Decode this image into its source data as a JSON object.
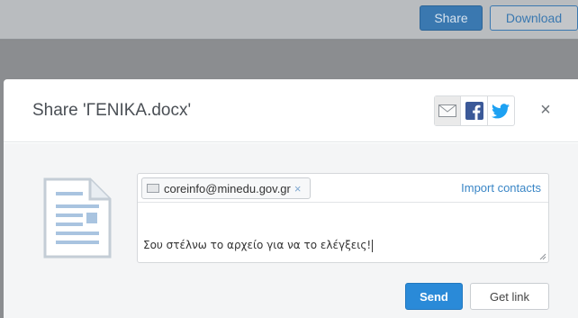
{
  "background": {
    "share_label": "Share",
    "download_label": "Download"
  },
  "dialog": {
    "title": "Share 'ΓΕΝΙΚΑ.docx'",
    "social": {
      "email_icon": "email-icon",
      "facebook_icon": "facebook-icon",
      "twitter_icon": "twitter-icon"
    },
    "recipient": "coreinfo@minedu.gov.gr",
    "remove_glyph": "×",
    "import_contacts_label": "Import contacts",
    "message": "Σου στέλνω το αρχείο για να το ελέγξεις!",
    "send_label": "Send",
    "get_link_label": "Get link",
    "close_glyph": "×"
  },
  "colors": {
    "primary": "#2a8ad8",
    "link": "#3a86c6",
    "facebook": "#3b5998",
    "twitter": "#1da1f2"
  }
}
